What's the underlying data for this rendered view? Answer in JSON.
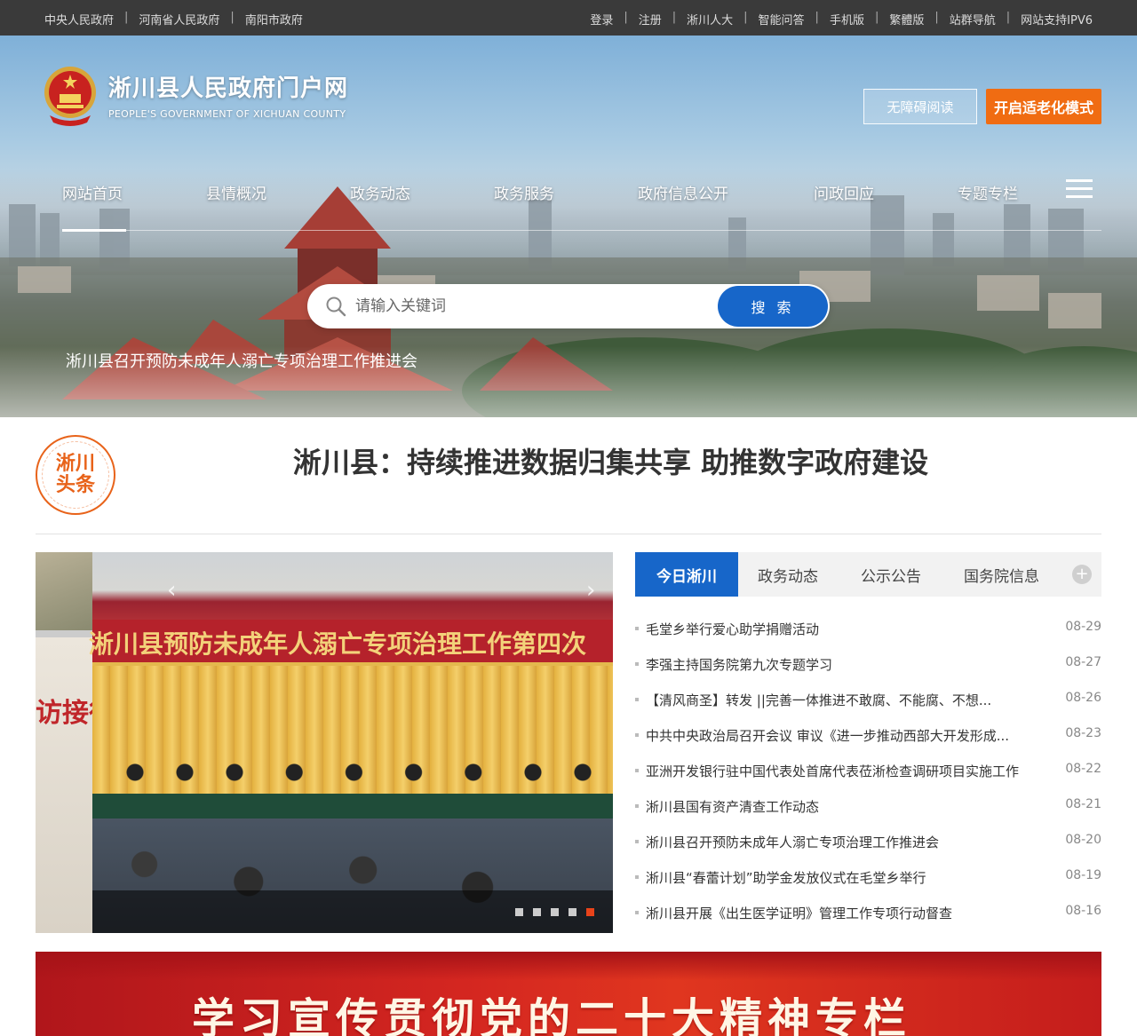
{
  "topbar": {
    "left_links": [
      "中央人民政府",
      "河南省人民政府",
      "南阳市政府"
    ],
    "right_links": [
      "登录",
      "注册",
      "淅川人大",
      "智能问答",
      "手机版",
      "繁體版",
      "站群导航",
      "网站支持IPV6"
    ]
  },
  "header": {
    "title_cn": "淅川县人民政府门户网",
    "title_en": "PEOPLE'S GOVERNMENT OF XICHUAN COUNTY",
    "accessible_label": "无障碍阅读",
    "elder_mode_label": "开启适老化模式"
  },
  "nav": {
    "items": [
      "网站首页",
      "县情概况",
      "政务动态",
      "政务服务",
      "政府信息公开",
      "问政回应",
      "专题专栏"
    ],
    "active": "网站首页",
    "menu_icon": "hamburger-menu-icon"
  },
  "search": {
    "placeholder": "请输入关键词",
    "button_label": "搜 索",
    "icon": "search-icon"
  },
  "headline": {
    "badge_line1": "淅川",
    "badge_line2": "头条",
    "title": "淅川县：持续推进数据归集共享 助推数字政府建设"
  },
  "carousel": {
    "slide_banner_text": "淅川县预防未成年人溺亡专项治理工作第四次",
    "thumb_text": "访接待",
    "caption": "淅川县召开预防未成年人溺亡专项治理工作推进会",
    "dot_count": 5,
    "active_dot": 5
  },
  "news_tabs": {
    "tabs": [
      "今日淅川",
      "政务动态",
      "公示公告",
      "国务院信息"
    ],
    "active": "今日淅川",
    "more_label": "+"
  },
  "news": [
    {
      "title": "毛堂乡举行爱心助学捐赠活动",
      "date": "08-29"
    },
    {
      "title": "李强主持国务院第九次专题学习",
      "date": "08-27"
    },
    {
      "title": "【清风商圣】转发 ||完善一体推进不敢腐、不能腐、不想...",
      "date": "08-26"
    },
    {
      "title": "中共中央政治局召开会议 审议《进一步推动西部大开发形成...",
      "date": "08-23"
    },
    {
      "title": "亚洲开发银行驻中国代表处首席代表莅淅检查调研项目实施工作",
      "date": "08-22"
    },
    {
      "title": "淅川县国有资产清查工作动态",
      "date": "08-21"
    },
    {
      "title": "淅川县召开预防未成年人溺亡专项治理工作推进会",
      "date": "08-20"
    },
    {
      "title": "淅川县“春蕾计划”助学金发放仪式在毛堂乡举行",
      "date": "08-19"
    },
    {
      "title": "淅川县开展《出生医学证明》管理工作专项行动督查",
      "date": "08-16"
    }
  ],
  "banner": {
    "text": "学习宣传贯彻党的二十大精神专栏"
  },
  "colors": {
    "topbar": "#3a3a3a",
    "accent_blue": "#1766c9",
    "accent_orange": "#f06c12",
    "banner_red": "#d42620"
  }
}
